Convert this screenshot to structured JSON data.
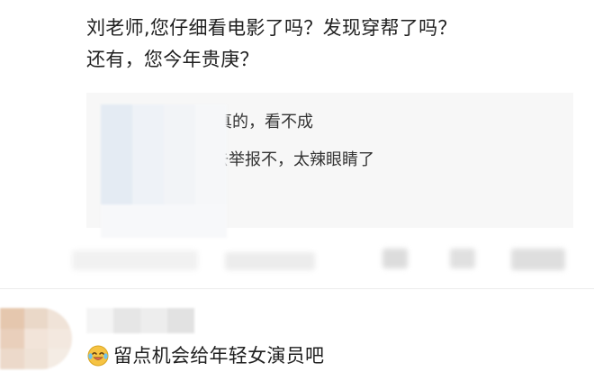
{
  "comment": {
    "lines": [
      "刘老师,您仔细看电影了吗？发现穿帮了吗？",
      "还有，您今年贵庚？"
    ]
  },
  "replies": [
    {
      "text": "：说真的，看不成"
    },
    {
      "text": "：可以去举报不，太辣眼睛了"
    }
  ],
  "comment2": {
    "emoji": "laughing-crying-face-icon",
    "text": "留点机会给年轻女演员吧"
  },
  "colors": {
    "reply_box_bg": "#f7f7f7",
    "text": "#1f1f1f",
    "emoji_face": "#f6c343"
  }
}
